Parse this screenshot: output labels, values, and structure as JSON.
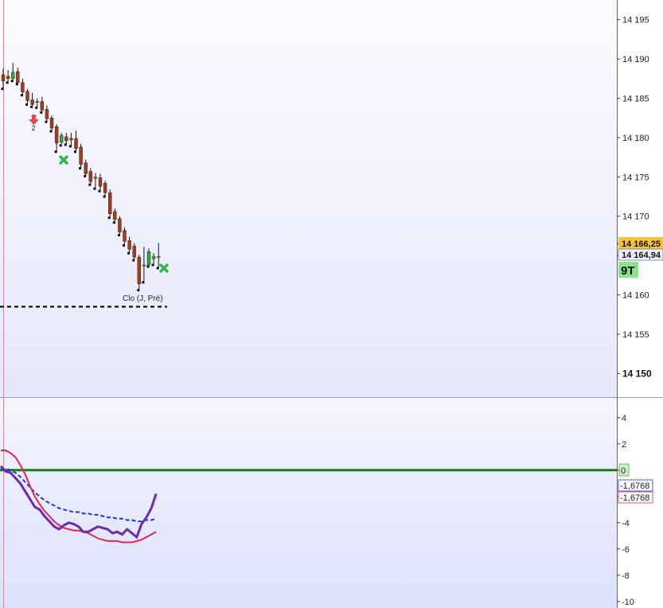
{
  "chart_data": [
    {
      "type": "candlestick",
      "y_ticks": [
        "14 195",
        "14 190",
        "14 185",
        "14 180",
        "14 175",
        "14 170",
        "14 165",
        "14 160",
        "14 155",
        "14 150"
      ],
      "y_tick_values": [
        14195,
        14190,
        14185,
        14180,
        14175,
        14170,
        14165,
        14160,
        14155,
        14150
      ],
      "ylim": [
        14147,
        14197.5
      ],
      "candles": [
        {
          "o": 14188.0,
          "h": 14188.8,
          "l": 14186.2,
          "c": 14187.2
        },
        {
          "o": 14187.8,
          "h": 14188.6,
          "l": 14187.0,
          "c": 14187.5
        },
        {
          "o": 14187.5,
          "h": 14189.5,
          "l": 14187.2,
          "c": 14188.3
        },
        {
          "o": 14188.4,
          "h": 14188.9,
          "l": 14186.8,
          "c": 14187.0
        },
        {
          "o": 14187.0,
          "h": 14187.5,
          "l": 14185.4,
          "c": 14185.8
        },
        {
          "o": 14185.9,
          "h": 14186.2,
          "l": 14184.2,
          "c": 14184.7
        },
        {
          "o": 14184.8,
          "h": 14185.7,
          "l": 14183.9,
          "c": 14184.2
        },
        {
          "o": 14184.5,
          "h": 14185.0,
          "l": 14183.8,
          "c": 14184.6
        },
        {
          "o": 14184.6,
          "h": 14185.2,
          "l": 14183.2,
          "c": 14183.5
        },
        {
          "o": 14183.6,
          "h": 14184.1,
          "l": 14182.0,
          "c": 14182.4
        },
        {
          "o": 14182.5,
          "h": 14182.8,
          "l": 14180.8,
          "c": 14181.2
        },
        {
          "o": 14181.4,
          "h": 14181.7,
          "l": 14178.2,
          "c": 14179.3
        },
        {
          "o": 14179.4,
          "h": 14180.6,
          "l": 14179.0,
          "c": 14180.3
        },
        {
          "o": 14180.1,
          "h": 14180.6,
          "l": 14179.1,
          "c": 14179.6
        },
        {
          "o": 14179.9,
          "h": 14180.6,
          "l": 14178.9,
          "c": 14179.7
        },
        {
          "o": 14179.9,
          "h": 14180.9,
          "l": 14178.2,
          "c": 14178.6
        },
        {
          "o": 14178.8,
          "h": 14179.2,
          "l": 14176.1,
          "c": 14176.6
        },
        {
          "o": 14176.8,
          "h": 14177.2,
          "l": 14175.1,
          "c": 14175.4
        },
        {
          "o": 14175.7,
          "h": 14176.1,
          "l": 14174.0,
          "c": 14174.4
        },
        {
          "o": 14174.8,
          "h": 14175.5,
          "l": 14173.5,
          "c": 14175.0
        },
        {
          "o": 14174.9,
          "h": 14175.4,
          "l": 14173.2,
          "c": 14173.8
        },
        {
          "o": 14174.2,
          "h": 14174.5,
          "l": 14172.5,
          "c": 14173.0
        },
        {
          "o": 14173.0,
          "h": 14173.4,
          "l": 14169.8,
          "c": 14170.3
        },
        {
          "o": 14170.6,
          "h": 14171.0,
          "l": 14169.2,
          "c": 14169.6
        },
        {
          "o": 14169.7,
          "h": 14170.0,
          "l": 14167.6,
          "c": 14168.0
        },
        {
          "o": 14168.2,
          "h": 14168.6,
          "l": 14166.3,
          "c": 14166.8
        },
        {
          "o": 14166.9,
          "h": 14167.4,
          "l": 14165.3,
          "c": 14165.8
        },
        {
          "o": 14166.2,
          "h": 14166.6,
          "l": 14164.4,
          "c": 14164.8
        },
        {
          "o": 14164.8,
          "h": 14165.1,
          "l": 14160.6,
          "c": 14161.4
        },
        {
          "o": 14163.7,
          "h": 14166.1,
          "l": 14161.6,
          "c": 14163.8
        },
        {
          "o": 14163.8,
          "h": 14165.9,
          "l": 14163.6,
          "c": 14165.5
        },
        {
          "o": 14164.6,
          "h": 14165.3,
          "l": 14163.8,
          "c": 14164.9
        },
        {
          "o": 14164.9,
          "h": 14166.6,
          "l": 14163.4,
          "c": 14164.9
        }
      ],
      "price_labels": {
        "last": "14 166,25",
        "close": "14 164,94",
        "tag": "9T"
      },
      "colors": {
        "up": "#2ea83a",
        "down": "#a33c1c",
        "last_label_bg": "#f4c43c",
        "tag_bg": "#8be38b"
      },
      "prev_close": {
        "label": "Clo (J, Pré)",
        "value": 14158.5
      },
      "annotations": {
        "arrow_number": "2"
      }
    },
    {
      "type": "line",
      "y_ticks": [
        "4",
        "2",
        "0",
        "-2",
        "-4",
        "-6",
        "-8",
        "-10"
      ],
      "y_tick_values": [
        4,
        2,
        0,
        -2,
        -4,
        -6,
        -8,
        -10
      ],
      "ylim": [
        -10.5,
        5.5
      ],
      "zero_label": "0",
      "value_labels": [
        "-1,6768",
        "-1,6768"
      ],
      "colors": {
        "purple": "#6a2bb0",
        "red": "#e8264c",
        "blue": "#1a3bd6",
        "zero_line": "#1c7a1c"
      },
      "series_purple": [
        0.3,
        -0.1,
        -0.2,
        -0.6,
        -1.0,
        -1.6,
        -2.2,
        -2.8,
        -3.0,
        -3.5,
        -3.9,
        -4.3,
        -4.5,
        -4.2,
        -4.0,
        -4.1,
        -4.3,
        -4.7,
        -4.7,
        -4.5,
        -4.3,
        -4.4,
        -4.5,
        -4.8,
        -4.7,
        -4.9,
        -4.5,
        -4.8,
        -5.1,
        -4.1,
        -3.6,
        -2.9,
        -1.8
      ],
      "series_red": [
        1.5,
        1.5,
        1.3,
        1.0,
        0.4,
        -0.3,
        -1.2,
        -2.0,
        -2.6,
        -3.1,
        -3.5,
        -3.9,
        -4.2,
        -4.4,
        -4.5,
        -4.6,
        -4.6,
        -4.7,
        -4.8,
        -5.0,
        -5.2,
        -5.3,
        -5.4,
        -5.4,
        -5.4,
        -5.5,
        -5.5,
        -5.5,
        -5.4,
        -5.3,
        -5.1,
        -4.9,
        -4.7
      ],
      "series_blue": [
        0.1,
        0.1,
        0.0,
        -0.2,
        -0.5,
        -0.9,
        -1.3,
        -1.7,
        -2.0,
        -2.3,
        -2.5,
        -2.7,
        -2.9,
        -3.0,
        -3.1,
        -3.2,
        -3.2,
        -3.3,
        -3.3,
        -3.4,
        -3.4,
        -3.5,
        -3.6,
        -3.6,
        -3.7,
        -3.7,
        -3.8,
        -3.8,
        -3.9,
        -3.9,
        -3.8,
        -3.8,
        -3.7
      ]
    }
  ]
}
